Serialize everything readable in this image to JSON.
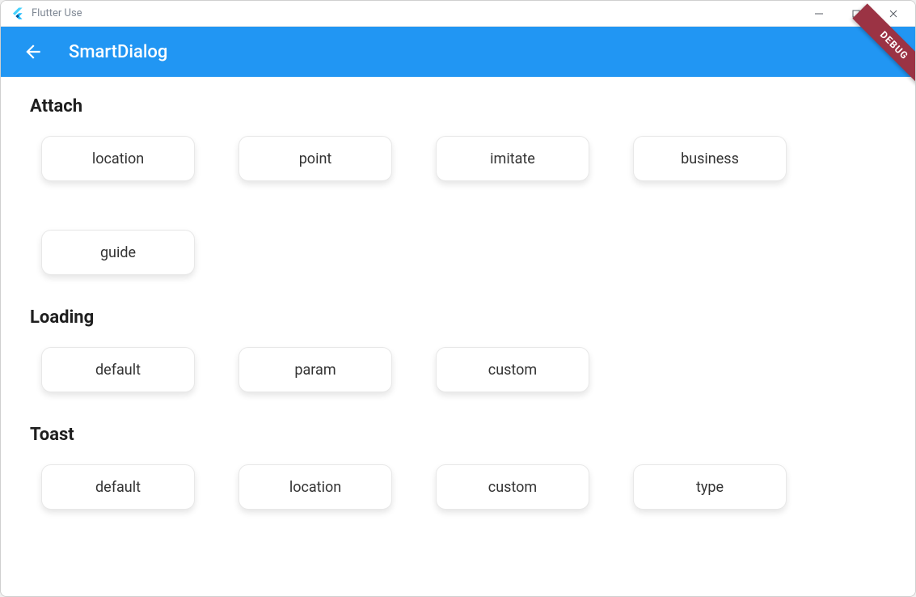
{
  "window": {
    "title": "Flutter Use"
  },
  "appbar": {
    "title": "SmartDialog",
    "debug_label": "DEBUG"
  },
  "sections": [
    {
      "title": "Attach",
      "buttons": [
        "location",
        "point",
        "imitate",
        "business",
        "guide"
      ]
    },
    {
      "title": "Loading",
      "buttons": [
        "default",
        "param",
        "custom"
      ]
    },
    {
      "title": "Toast",
      "buttons": [
        "default",
        "location",
        "custom",
        "type"
      ]
    }
  ]
}
